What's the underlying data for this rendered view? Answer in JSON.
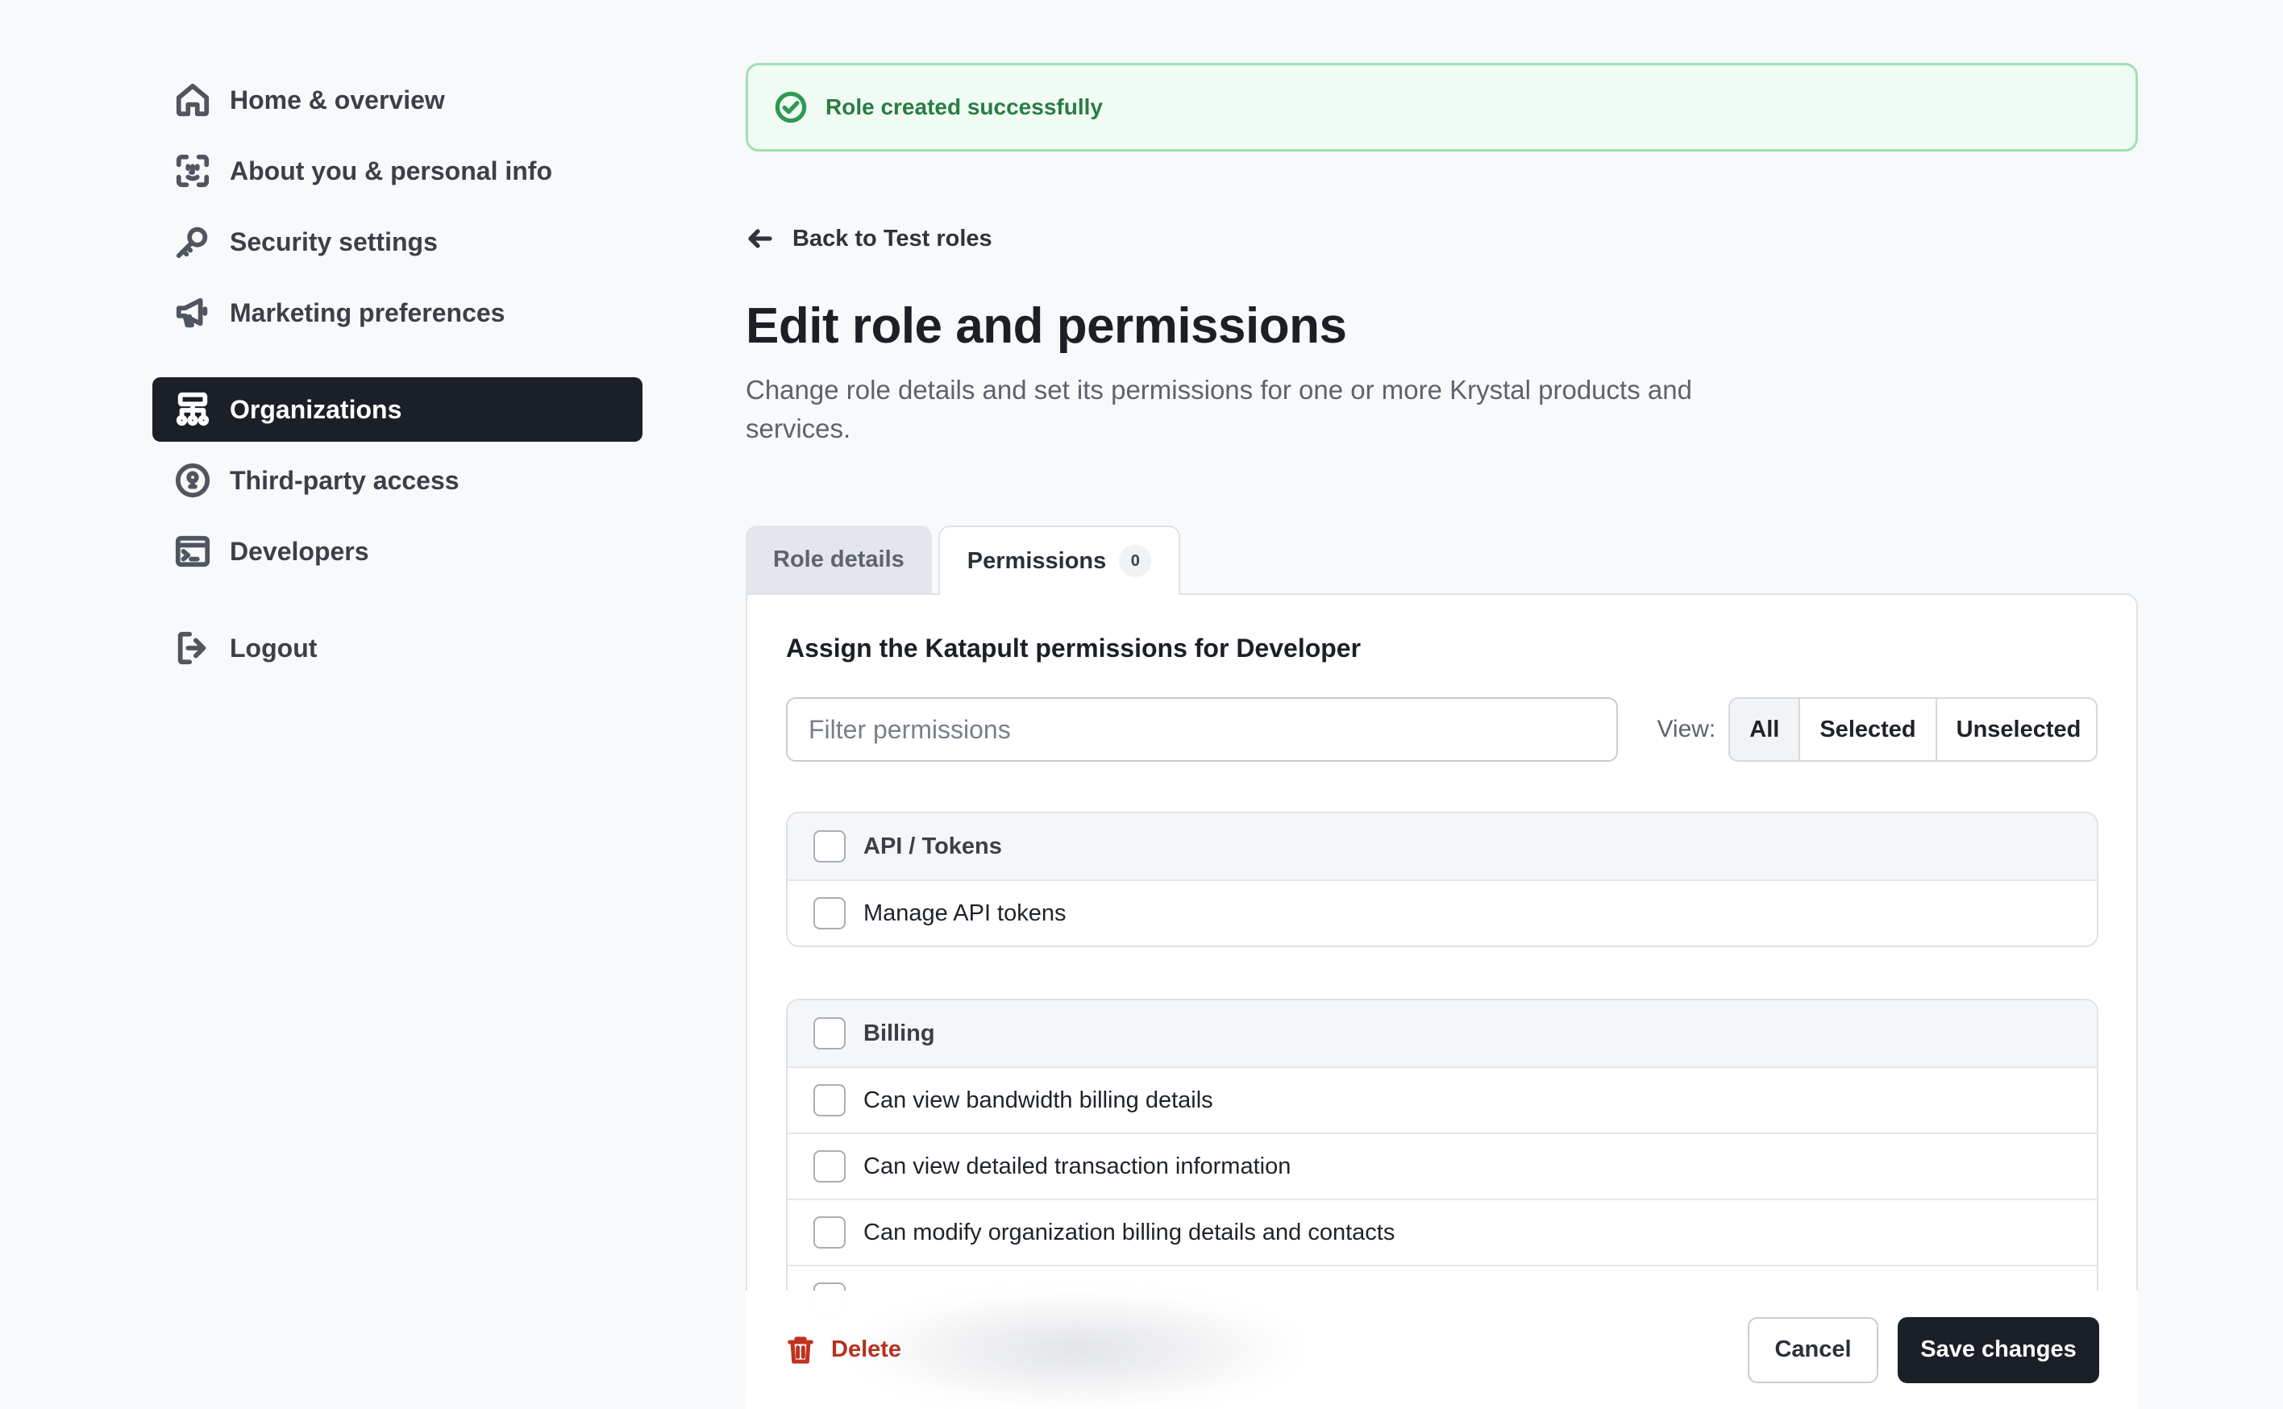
{
  "sidebar": {
    "items": [
      {
        "label": "Home & overview",
        "icon": "home-icon"
      },
      {
        "label": "About you & personal info",
        "icon": "face-id-icon"
      },
      {
        "label": "Security settings",
        "icon": "key-icon"
      },
      {
        "label": "Marketing preferences",
        "icon": "megaphone-icon"
      },
      {
        "label": "Organizations",
        "icon": "org-chart-icon",
        "active": true
      },
      {
        "label": "Third-party access",
        "icon": "lock-circle-icon"
      },
      {
        "label": "Developers",
        "icon": "terminal-icon"
      },
      {
        "label": "Logout",
        "icon": "logout-icon"
      }
    ]
  },
  "alert": {
    "message": "Role created successfully",
    "icon": "check-circle-icon",
    "color": "#2a7c43"
  },
  "back_link": {
    "label": "Back to Test roles",
    "icon": "arrow-left-icon"
  },
  "page": {
    "title": "Edit role and permissions",
    "subtitle": "Change role details and set its permissions for one or more Krystal products and services."
  },
  "tabs": [
    {
      "label": "Role details"
    },
    {
      "label": "Permissions",
      "badge": "0",
      "active": true
    }
  ],
  "panel": {
    "heading": "Assign the Katapult permissions for Developer",
    "filter_placeholder": "Filter permissions",
    "view_label": "View:",
    "view_options": [
      "All",
      "Selected",
      "Unselected"
    ],
    "view_selected": "All"
  },
  "permission_groups": [
    {
      "name": "API / Tokens",
      "permissions": [
        "Manage API tokens"
      ]
    },
    {
      "name": "Billing",
      "permissions": [
        "Can view bandwidth billing details",
        "Can view detailed transaction information",
        "Can modify organization billing details and contacts"
      ]
    }
  ],
  "footer": {
    "delete_label": "Delete",
    "cancel_label": "Cancel",
    "save_label": "Save changes",
    "danger_color": "#b4311f",
    "primary_color": "#1b2028"
  }
}
